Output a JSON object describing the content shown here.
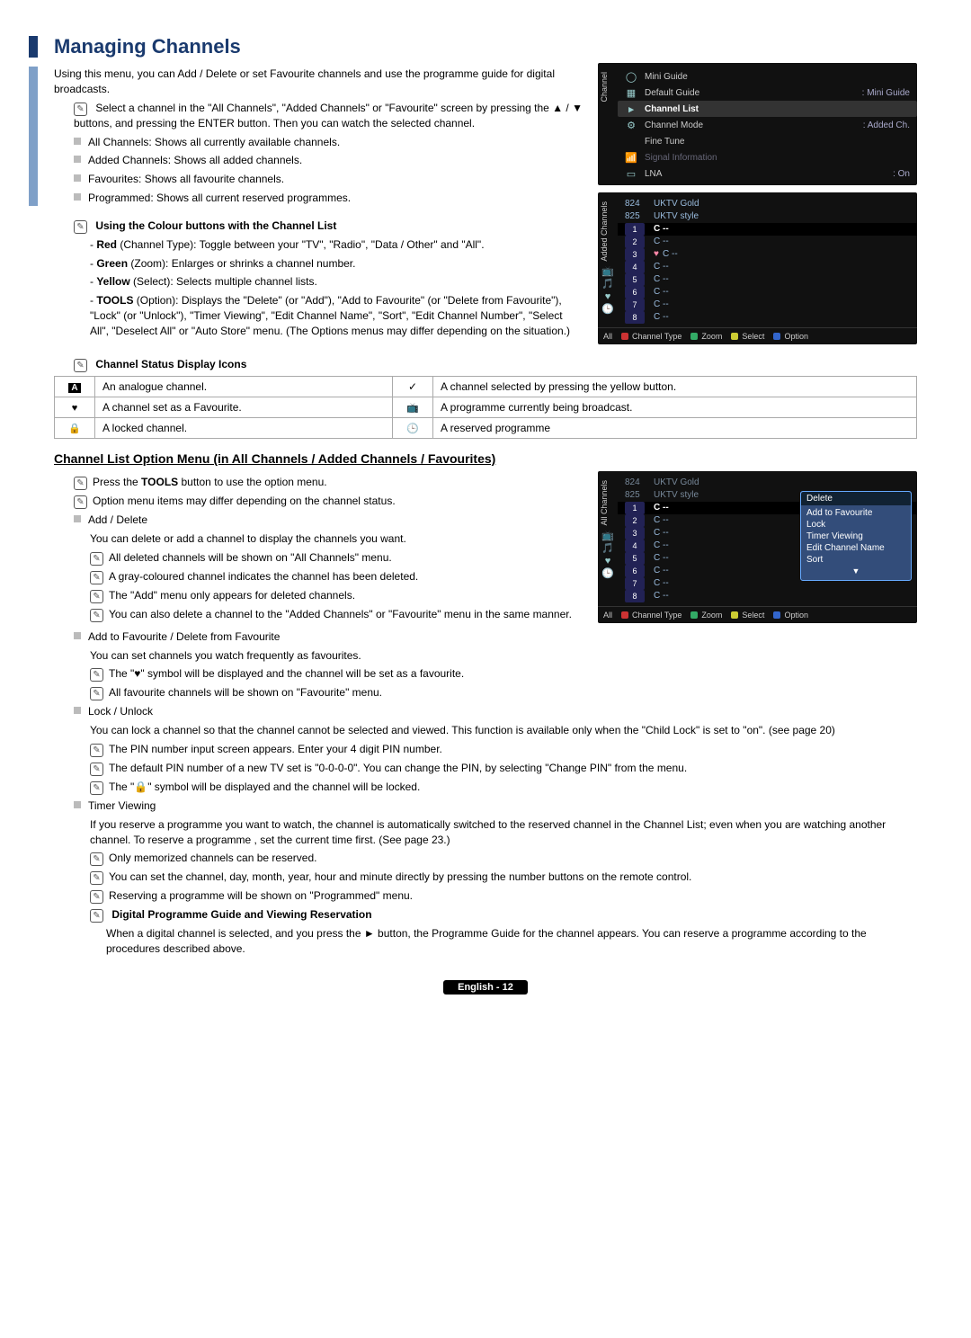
{
  "title": "Managing Channels",
  "intro": "Using this menu, you can Add / Delete or set Favourite channels and use the programme guide for digital broadcasts.",
  "select_note": "Select a channel in the \"All Channels\", \"Added Channels\" or \"Favourite\" screen by pressing the ▲ / ▼ buttons, and pressing the ENTER button. Then you can watch the selected channel.",
  "bullets_top": [
    "All Channels: Shows all currently available channels.",
    "Added Channels: Shows all added channels.",
    "Favourites: Shows all favourite channels.",
    "Programmed: Shows all current reserved programmes."
  ],
  "colour_heading": "Using the Colour buttons with the Channel List",
  "colour_items": [
    {
      "label": "Red",
      "rest": " (Channel Type): Toggle between your \"TV\", \"Radio\", \"Data / Other\" and \"All\"."
    },
    {
      "label": "Green",
      "rest": " (Zoom): Enlarges or shrinks a channel number."
    },
    {
      "label": "Yellow",
      "rest": " (Select): Selects multiple channel lists."
    },
    {
      "label": "TOOLS",
      "rest": " (Option): Displays the \"Delete\" (or \"Add\"), \"Add to Favourite\" (or \"Delete from Favourite\"), \"Lock\" (or \"Unlock\"), \"Timer Viewing\", \"Edit Channel Name\", \"Sort\", \"Edit Channel Number\", \"Select All\", \"Deselect All\" or \"Auto Store\" menu. (The Options menus may differ depending on the situation.)"
    }
  ],
  "menu_panel": {
    "side_label": "Channel",
    "items": [
      {
        "label": "Mini Guide",
        "value": ""
      },
      {
        "label": "Default Guide",
        "value": ": Mini Guide"
      },
      {
        "label": "Channel List",
        "value": "",
        "active": true
      },
      {
        "label": "Channel Mode",
        "value": ": Added Ch."
      },
      {
        "label": "Fine Tune",
        "value": ""
      },
      {
        "label": "Signal Information",
        "value": ""
      },
      {
        "label": "LNA",
        "value": ": On"
      }
    ]
  },
  "added_panel": {
    "side_label": "Added Channels",
    "top": [
      {
        "num": "824",
        "name": "UKTV Gold"
      },
      {
        "num": "825",
        "name": "UKTV style"
      }
    ],
    "rows": [
      {
        "num": "1",
        "name": "C --",
        "sel": true,
        "mark": ""
      },
      {
        "num": "2",
        "name": "C --",
        "mark": ""
      },
      {
        "num": "3",
        "name": "C --",
        "mark": "♥"
      },
      {
        "num": "4",
        "name": "C --",
        "mark": ""
      },
      {
        "num": "5",
        "name": "C --",
        "mark": ""
      },
      {
        "num": "6",
        "name": "C --",
        "mark": ""
      },
      {
        "num": "7",
        "name": "C --",
        "mark": ""
      },
      {
        "num": "8",
        "name": "C --",
        "mark": ""
      }
    ],
    "footer": {
      "all": "All",
      "ct": "Channel Type",
      "zoom": "Zoom",
      "select": "Select",
      "option": "Option"
    }
  },
  "status_heading": "Channel Status Display Icons",
  "status_rows": [
    {
      "icon": "A",
      "text": "An analogue channel.",
      "icon2": "✓",
      "text2": "A channel selected by pressing the yellow button."
    },
    {
      "icon": "♥",
      "text": "A channel set as a Favourite.",
      "icon2": "📺",
      "text2": "A programme currently being broadcast."
    },
    {
      "icon": "🔒",
      "text": "A locked channel.",
      "icon2": "🕒",
      "text2": "A reserved programme"
    }
  ],
  "subhead": "Channel List Option Menu (in All Channels / Added Channels / Favourites)",
  "sub_notes": [
    "Press the TOOLS button to use the option menu.",
    "Option menu items may differ depending on the channel status."
  ],
  "add_delete": {
    "title": "Add / Delete",
    "lead": "You can delete or add a channel to display the channels you want.",
    "notes": [
      "All deleted channels will be shown on \"All Channels\" menu.",
      "A gray-coloured channel indicates the channel has been deleted.",
      "The \"Add\" menu only appears for deleted channels.",
      "You can also delete a channel to the \"Added Channels\" or \"Favourite\" menu in the same manner."
    ]
  },
  "fav": {
    "title": "Add to Favourite / Delete from Favourite",
    "lead": "You can set channels you watch frequently as favourites.",
    "notes": [
      "The \"♥\" symbol will be displayed and the channel will be set as a favourite.",
      "All favourite channels will be shown on \"Favourite\" menu."
    ]
  },
  "lock": {
    "title": "Lock / Unlock",
    "lead": "You can lock a channel so that the channel cannot be selected and viewed. This function is available only when the \"Child Lock\" is set to \"on\". (see page 20)",
    "notes": [
      "The PIN number input screen appears. Enter your 4 digit PIN number.",
      "The default PIN number of a new TV set is \"0-0-0-0\". You can change the PIN, by selecting \"Change PIN\" from the menu.",
      "The \"🔒\" symbol will be displayed and the channel will be locked."
    ]
  },
  "timer": {
    "title": "Timer Viewing",
    "lead": "If you reserve a programme you want to watch, the channel is automatically switched to the reserved channel in the Channel List; even when you are watching another channel. To reserve a programme , set the current time first. (See page 23.)",
    "notes": [
      "Only memorized channels can be reserved.",
      "You can set the channel, day, month, year, hour and minute directly by pressing the number buttons on the remote control.",
      "Reserving a programme will be shown on \"Programmed\" menu."
    ],
    "digital_head": "Digital Programme Guide and Viewing Reservation",
    "digital_body": "When a digital channel is selected, and you press the ► button, the Programme Guide for the channel appears. You can reserve a programme according to the procedures described above."
  },
  "all_panel": {
    "side_label": "All Channels",
    "top": [
      {
        "num": "824",
        "name": "UKTV Gold"
      },
      {
        "num": "825",
        "name": "UKTV style"
      }
    ],
    "rows": [
      {
        "num": "1",
        "name": "C --",
        "sel": true
      },
      {
        "num": "2",
        "name": "C --"
      },
      {
        "num": "3",
        "name": "C --"
      },
      {
        "num": "4",
        "name": "C --"
      },
      {
        "num": "5",
        "name": "C --"
      },
      {
        "num": "6",
        "name": "C --"
      },
      {
        "num": "7",
        "name": "C --"
      },
      {
        "num": "8",
        "name": "C --"
      }
    ],
    "popup": [
      "Delete",
      "Add to Favourite",
      "Lock",
      "Timer Viewing",
      "Edit Channel Name",
      "Sort",
      "▼"
    ],
    "footer": {
      "all": "All",
      "ct": "Channel Type",
      "zoom": "Zoom",
      "select": "Select",
      "option": "Option"
    }
  },
  "page_foot": "English - 12",
  "enter_label": "ENTER"
}
